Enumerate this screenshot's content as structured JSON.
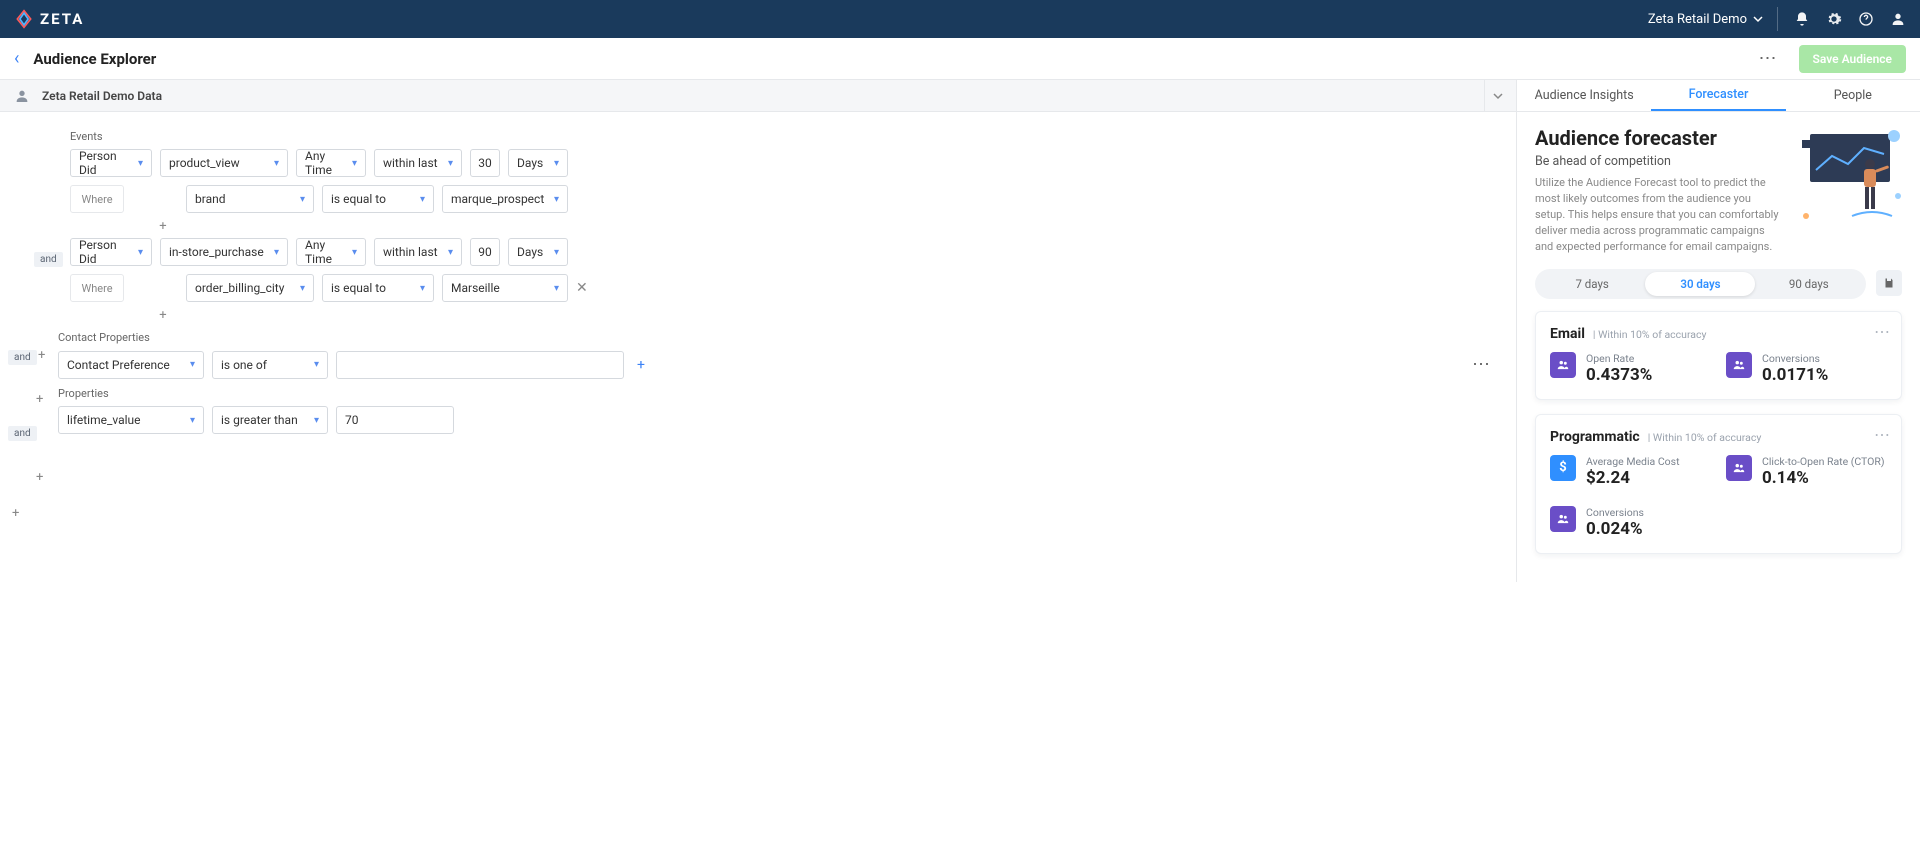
{
  "topbar": {
    "brand": "ZETA",
    "account": "Zeta Retail Demo"
  },
  "header": {
    "title": "Audience Explorer",
    "save_label": "Save Audience"
  },
  "datasource": {
    "name": "Zeta Retail Demo Data"
  },
  "builder": {
    "events_label": "Events",
    "contact_label": "Contact Properties",
    "props_label": "Properties",
    "and_label": "and",
    "where_label": "Where",
    "event1": {
      "action": "Person Did",
      "event": "product_view",
      "time": "Any Time",
      "within": "within last",
      "num": "30",
      "unit": "Days",
      "cond_field": "brand",
      "cond_op": "is equal to",
      "cond_val": "marque_prospect"
    },
    "event2": {
      "action": "Person Did",
      "event": "in-store_purchase",
      "time": "Any Time",
      "within": "within last",
      "num": "90",
      "unit": "Days",
      "cond_field": "order_billing_city",
      "cond_op": "is equal to",
      "cond_val": "Marseille"
    },
    "contact": {
      "field": "Contact Preference",
      "op": "is one of",
      "val": ""
    },
    "prop": {
      "field": "lifetime_value",
      "op": "is greater than",
      "val": "70"
    }
  },
  "side": {
    "tabs": {
      "insights": "Audience Insights",
      "forecaster": "Forecaster",
      "people": "People"
    },
    "fc_title": "Audience forecaster",
    "fc_sub": "Be ahead of competition",
    "fc_desc": "Utilize the Audience Forecast tool to predict the most likely outcomes from the audience you setup. This helps ensure that you can comfortably deliver media across programmatic campaigns and expected performance for email campaigns.",
    "periods": {
      "p7": "7 days",
      "p30": "30 days",
      "p90": "90 days"
    },
    "email_card": {
      "title": "Email",
      "acc": "| Within 10% of accuracy",
      "open_rate_label": "Open Rate",
      "open_rate_value": "0.4373%",
      "conv_label": "Conversions",
      "conv_value": "0.0171%"
    },
    "prog_card": {
      "title": "Programmatic",
      "acc": "| Within 10% of accuracy",
      "amc_label": "Average Media Cost",
      "amc_value": "$2.24",
      "ctor_label": "Click-to-Open Rate (CTOR)",
      "ctor_value": "0.14%",
      "conv_label": "Conversions",
      "conv_value": "0.024%"
    }
  }
}
